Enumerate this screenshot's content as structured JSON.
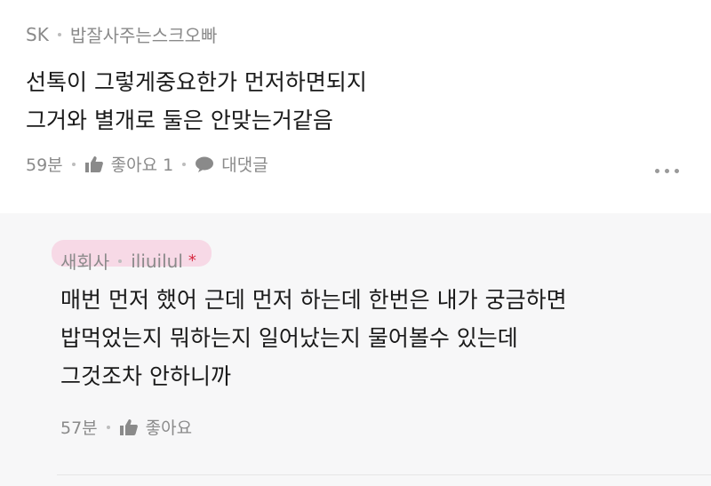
{
  "comment": {
    "author": "SK",
    "nickname": "밥잘사주는스크오빠",
    "lines": [
      "선톡이 그렇게중요한가 먼저하면되지",
      "그거와 별개로 둘은 안맞는거같음"
    ],
    "time": "59분",
    "like_label": "좋아요 1",
    "reply_label": "대댓글",
    "more_icon": "more-horizontal-icon"
  },
  "reply": {
    "author": "새회사",
    "nickname": "iliuilul",
    "writer_mark": "*",
    "lines": [
      "매번 먼저 했어 근데 먼저 하는데 한번은 내가 궁금하면",
      "밥먹었는지 뭐하는지 일어났는지 물어볼수 있는데",
      "그것조차 안하니까"
    ],
    "time": "57분",
    "like_label": "좋아요"
  },
  "colors": {
    "meta": "#8a8a8a",
    "highlight": "#f7cfe0",
    "writer_mark": "#d6283f",
    "reply_bg": "#f7f7f8"
  }
}
